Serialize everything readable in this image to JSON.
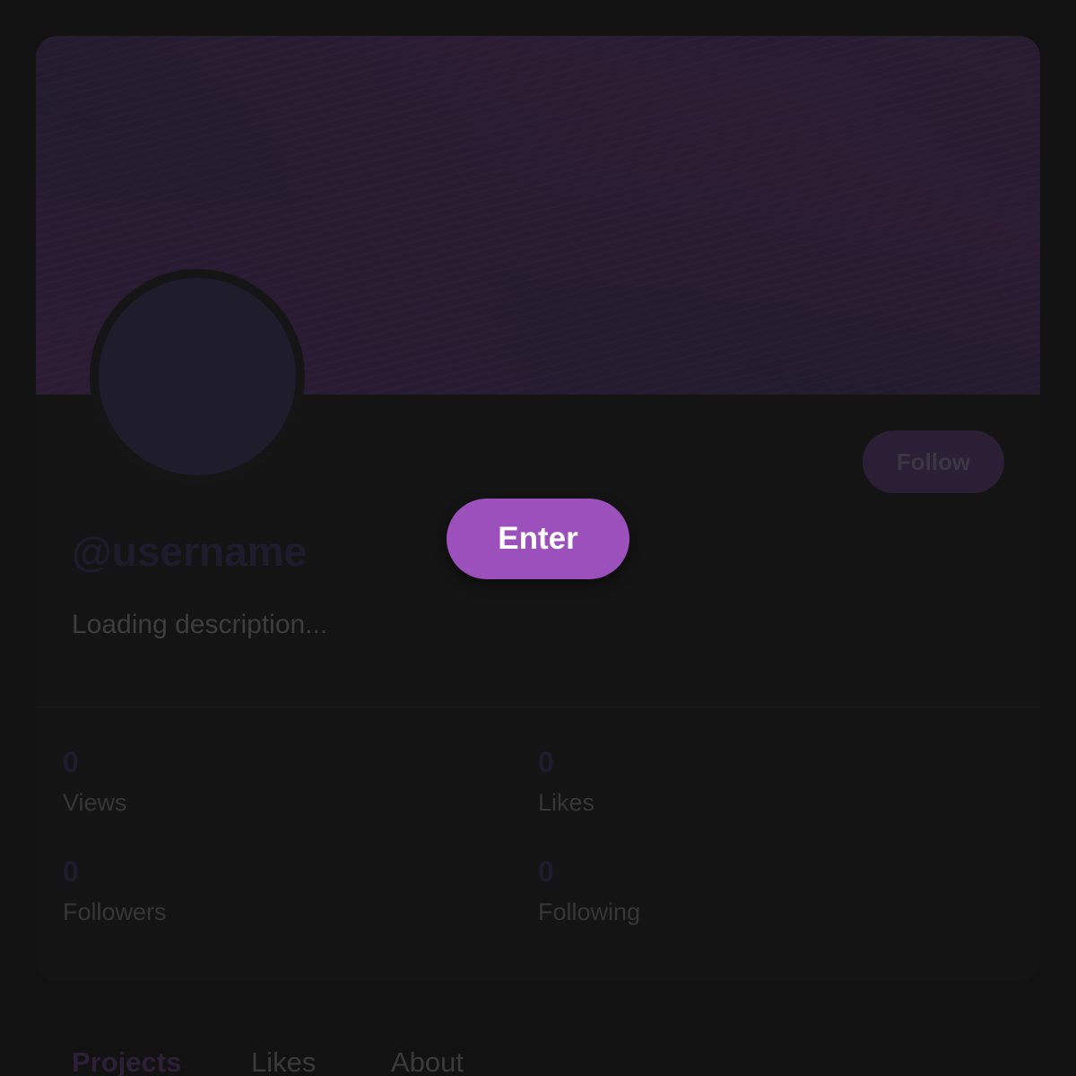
{
  "profile": {
    "username": "@username",
    "description": "Loading description...",
    "follow_label": "Follow"
  },
  "stats": {
    "views": {
      "value": "0",
      "label": "Views"
    },
    "likes": {
      "value": "0",
      "label": "Likes"
    },
    "followers": {
      "value": "0",
      "label": "Followers"
    },
    "following": {
      "value": "0",
      "label": "Following"
    }
  },
  "tabs": [
    {
      "label": "Projects",
      "active": true
    },
    {
      "label": "Likes",
      "active": false
    },
    {
      "label": "About",
      "active": false
    }
  ],
  "overlay": {
    "enter_label": "Enter"
  },
  "colors": {
    "accent": "#9b50bb",
    "background": "#121212",
    "card": "#141414"
  }
}
